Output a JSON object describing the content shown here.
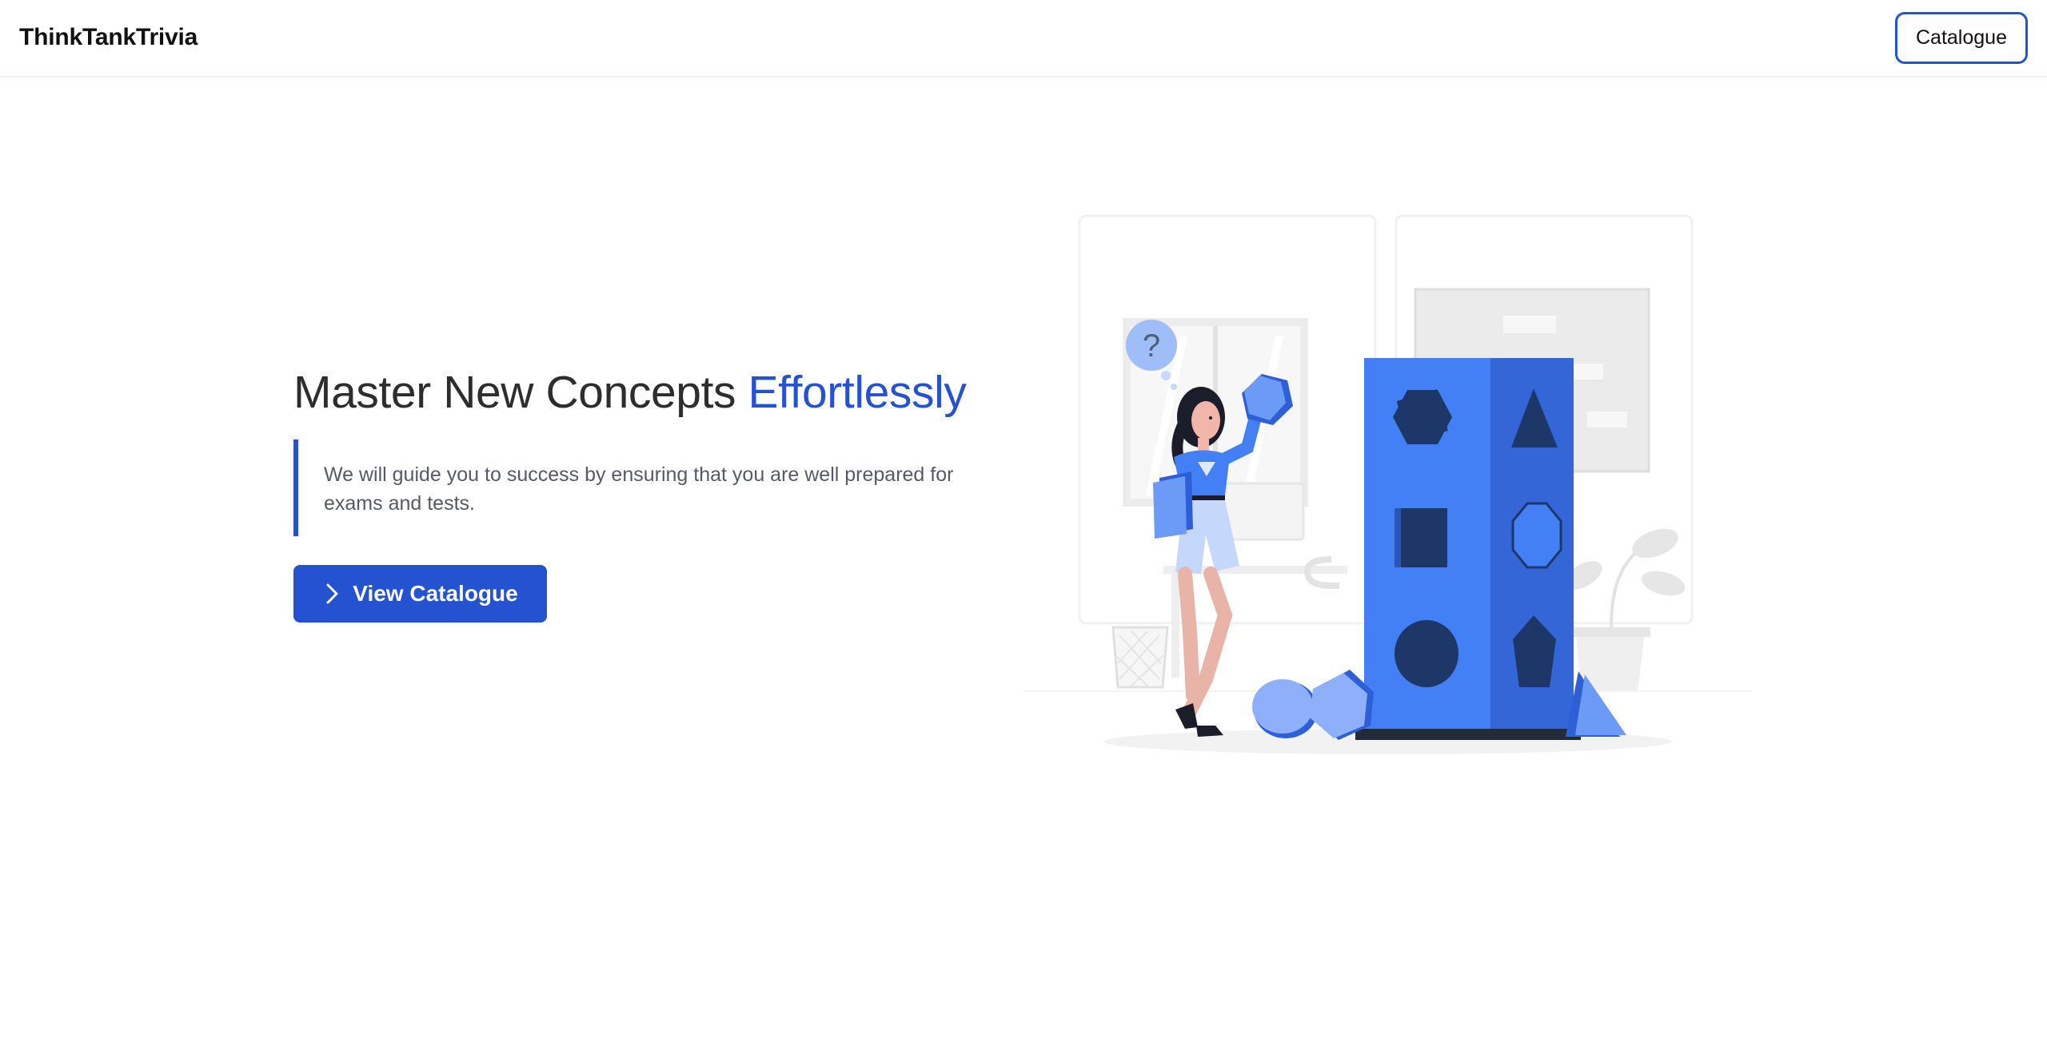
{
  "header": {
    "brand": "ThinkTankTrivia",
    "nav_button_label": "Catalogue"
  },
  "hero": {
    "title_main": "Master New Concepts ",
    "title_accent": "Effortlessly",
    "description": "We will guide you to success by ensuring that you are well prepared for exams and tests.",
    "cta_label": "View Catalogue",
    "cta_icon": "chevron-right-icon"
  },
  "illustration": {
    "question_mark": "?",
    "accent_color": "#4380f5",
    "dark_color": "#1e3769"
  },
  "colors": {
    "primary": "#2552d0",
    "text": "#2d2d2d",
    "muted": "#555b66"
  }
}
